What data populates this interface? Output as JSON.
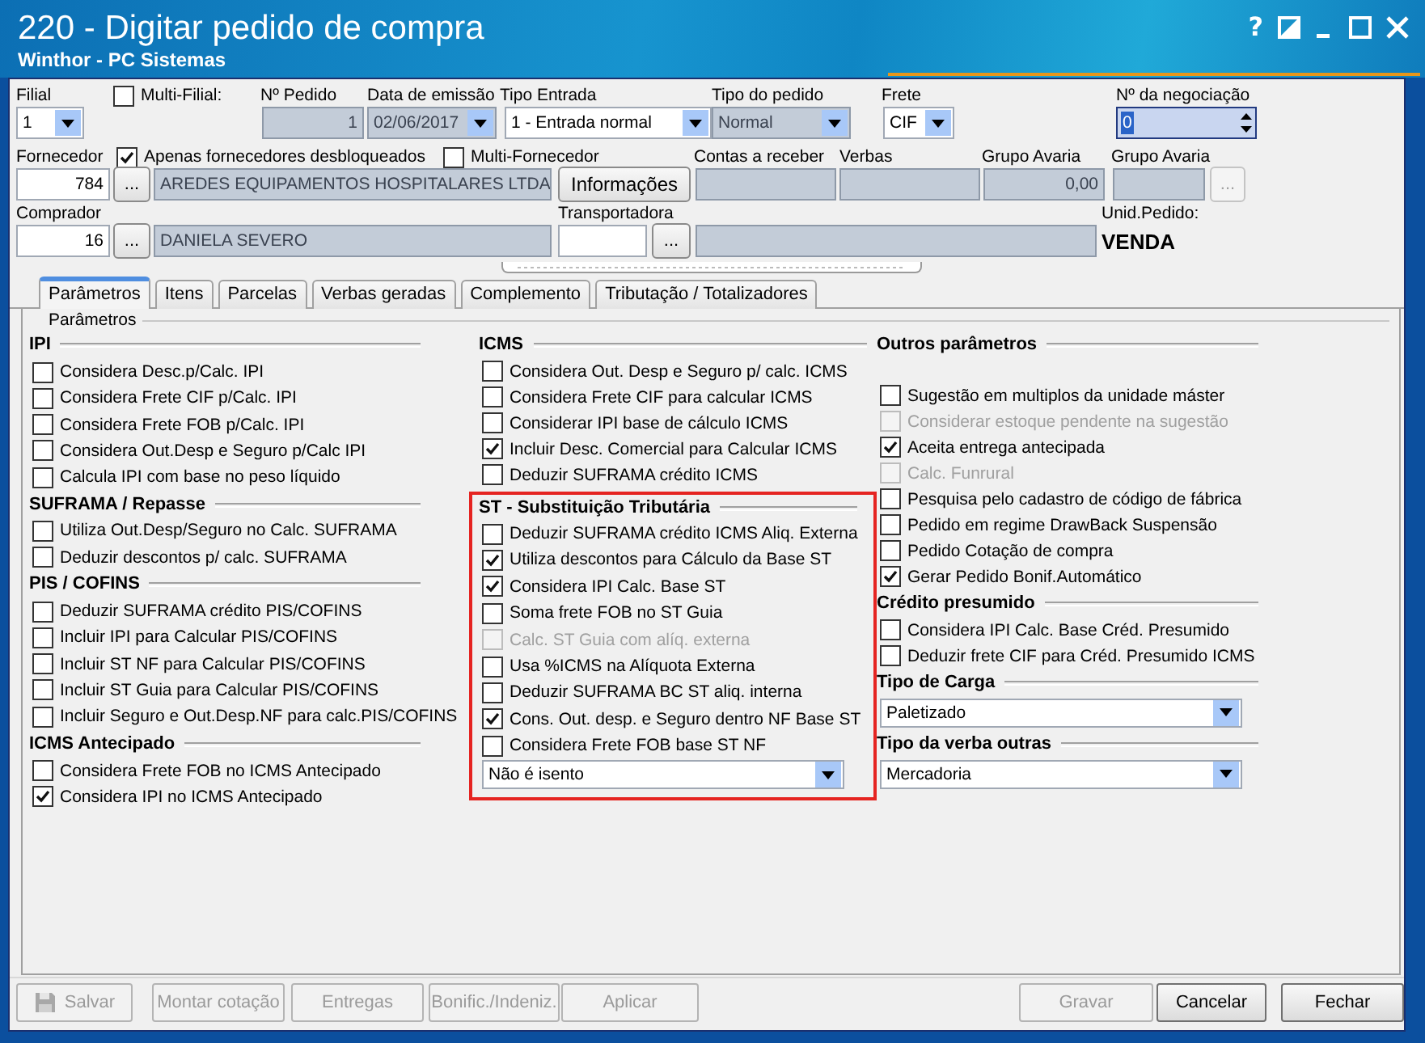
{
  "window": {
    "title": "220 - Digitar pedido de compra",
    "subtitle": "Winthor - PC Sistemas",
    "help": "?"
  },
  "header": {
    "rows": [
      {
        "labels": [
          {
            "kind": "label",
            "text": "Filial"
          },
          {
            "kind": "checkbox",
            "label": "Multi-Filial:",
            "checked": false
          },
          {
            "kind": "label",
            "text": "Nº Pedido"
          },
          {
            "kind": "label",
            "text": "Data de emissão"
          },
          {
            "kind": "label",
            "text": "Tipo Entrada"
          },
          {
            "kind": "label",
            "text": "Tipo do pedido"
          },
          {
            "kind": "label",
            "text": "Frete"
          },
          {
            "kind": "label",
            "text": "Nº da negociação"
          }
        ],
        "controls": [
          {
            "kind": "select",
            "value": "1",
            "disabled": false
          },
          {
            "kind": "number",
            "value": "1",
            "disabled": true
          },
          {
            "kind": "select",
            "value": "02/06/2017",
            "disabled": true
          },
          {
            "kind": "select",
            "value": "1 - Entrada normal",
            "disabled": false
          },
          {
            "kind": "select",
            "value": "Normal",
            "disabled": true
          },
          {
            "kind": "select",
            "value": "CIF",
            "disabled": false
          },
          {
            "kind": "spinner",
            "value": "0",
            "disabled": false
          }
        ]
      },
      {
        "labels": [
          {
            "kind": "label",
            "text": "Fornecedor"
          },
          {
            "kind": "checkbox",
            "label": "Apenas fornecedores desbloqueados",
            "checked": true
          },
          {
            "kind": "checkbox",
            "label": "Multi-Fornecedor",
            "checked": false
          },
          {
            "kind": "label",
            "text": "Contas a receber"
          },
          {
            "kind": "label",
            "text": "Verbas"
          },
          {
            "kind": "label",
            "text": "Grupo Avaria"
          },
          {
            "kind": "label",
            "text": "Grupo Avaria"
          }
        ],
        "controls": [
          {
            "kind": "number",
            "value": "784",
            "disabled": false
          },
          {
            "kind": "ellipsis",
            "label": "...",
            "disabled": false
          },
          {
            "kind": "text",
            "value": "AREDES EQUIPAMENTOS HOSPITALARES LTDA",
            "disabled": true
          },
          {
            "kind": "button",
            "label": "Informações",
            "disabled": false
          },
          {
            "kind": "text",
            "disabled": true
          },
          {
            "kind": "text",
            "disabled": true
          },
          {
            "kind": "number",
            "value": "0,00",
            "disabled": true
          },
          {
            "kind": "text",
            "disabled": true
          },
          {
            "kind": "ellipsis",
            "label": "...",
            "disabled": true
          }
        ]
      },
      {
        "labels": [
          {
            "kind": "label",
            "text": "Comprador"
          },
          {
            "kind": "label",
            "text": "Transportadora"
          },
          {
            "kind": "label",
            "text": "Unid.Pedido:"
          }
        ],
        "controls": [
          {
            "kind": "number",
            "value": "16",
            "disabled": false
          },
          {
            "kind": "ellipsis",
            "label": "...",
            "disabled": false
          },
          {
            "kind": "text",
            "value": "DANIELA SEVERO",
            "disabled": true
          },
          {
            "kind": "text",
            "disabled": false
          },
          {
            "kind": "ellipsis",
            "label": "...",
            "disabled": false
          },
          {
            "kind": "text",
            "disabled": true
          },
          {
            "kind": "bold",
            "value": "VENDA"
          }
        ]
      }
    ]
  },
  "tabs": [
    {
      "label": "Parâmetros",
      "selected": true
    },
    {
      "label": "Itens",
      "selected": false
    },
    {
      "label": "Parcelas",
      "selected": false
    },
    {
      "label": "Verbas geradas",
      "selected": false
    },
    {
      "label": "Complemento",
      "selected": false
    },
    {
      "label": "Tributação / Totalizadores",
      "selected": false
    }
  ],
  "parameters": {
    "title": "Parâmetros",
    "columns": [
      {
        "sections": [
          {
            "title": "IPI",
            "highlighted": false,
            "items": [
              {
                "kind": "checkbox",
                "label": "Considera Desc.p/Calc. IPI",
                "checked": false,
                "disabled": false
              },
              {
                "kind": "checkbox",
                "label": "Considera Frete CIF p/Calc. IPI",
                "checked": false,
                "disabled": false
              },
              {
                "kind": "checkbox",
                "label": "Considera Frete FOB p/Calc. IPI",
                "checked": false,
                "disabled": false
              },
              {
                "kind": "checkbox",
                "label": "Considera Out.Desp e Seguro p/Calc IPI",
                "checked": false,
                "disabled": false
              },
              {
                "kind": "checkbox",
                "label": "Calcula IPI com base no peso líquido",
                "checked": false,
                "disabled": false
              }
            ]
          },
          {
            "title": "SUFRAMA / Repasse",
            "highlighted": false,
            "items": [
              {
                "kind": "checkbox",
                "label": "Utiliza Out.Desp/Seguro no Calc. SUFRAMA",
                "checked": false,
                "disabled": false
              },
              {
                "kind": "checkbox",
                "label": "Deduzir descontos p/ calc. SUFRAMA",
                "checked": false,
                "disabled": false
              }
            ]
          },
          {
            "title": "PIS / COFINS",
            "highlighted": false,
            "items": [
              {
                "kind": "checkbox",
                "label": "Deduzir SUFRAMA crédito PIS/COFINS",
                "checked": false,
                "disabled": false
              },
              {
                "kind": "checkbox",
                "label": "Incluir IPI para Calcular PIS/COFINS",
                "checked": false,
                "disabled": false
              },
              {
                "kind": "checkbox",
                "label": "Incluir ST NF para Calcular PIS/COFINS",
                "checked": false,
                "disabled": false
              },
              {
                "kind": "checkbox",
                "label": "Incluir ST Guia para Calcular PIS/COFINS",
                "checked": false,
                "disabled": false
              },
              {
                "kind": "checkbox",
                "label": "Incluir Seguro e Out.Desp.NF para calc.PIS/COFINS",
                "checked": false,
                "disabled": false
              }
            ]
          },
          {
            "title": "ICMS Antecipado",
            "highlighted": false,
            "items": [
              {
                "kind": "checkbox",
                "label": "Considera Frete FOB no ICMS Antecipado",
                "checked": false,
                "disabled": false
              },
              {
                "kind": "checkbox",
                "label": "Considera IPI no ICMS Antecipado",
                "checked": true,
                "disabled": false
              }
            ]
          }
        ]
      },
      {
        "sections": [
          {
            "title": "ICMS",
            "highlighted": false,
            "items": [
              {
                "kind": "checkbox",
                "label": "Considera Out. Desp e Seguro p/ calc. ICMS",
                "checked": false,
                "disabled": false
              },
              {
                "kind": "checkbox",
                "label": "Considera Frete CIF para calcular ICMS",
                "checked": false,
                "disabled": false
              },
              {
                "kind": "checkbox",
                "label": "Considerar IPI base de cálculo ICMS",
                "checked": false,
                "disabled": false
              },
              {
                "kind": "checkbox",
                "label": "Incluir Desc. Comercial  para Calcular ICMS",
                "checked": true,
                "disabled": false
              },
              {
                "kind": "checkbox",
                "label": "Deduzir SUFRAMA crédito ICMS",
                "checked": false,
                "disabled": false
              }
            ]
          },
          {
            "title": "ST - Substituição Tributária",
            "highlighted": true,
            "items": [
              {
                "kind": "checkbox",
                "label": "Deduzir SUFRAMA crédito ICMS Aliq. Externa",
                "checked": false,
                "disabled": false
              },
              {
                "kind": "checkbox",
                "label": "Utiliza descontos para Cálculo da Base ST",
                "checked": true,
                "disabled": false
              },
              {
                "kind": "checkbox",
                "label": "Considera IPI Calc. Base ST",
                "checked": true,
                "disabled": false
              },
              {
                "kind": "checkbox",
                "label": "Soma frete FOB no ST Guia",
                "checked": false,
                "disabled": false
              },
              {
                "kind": "checkbox",
                "label": "Calc. ST Guia com alíq. externa",
                "checked": false,
                "disabled": true
              },
              {
                "kind": "checkbox",
                "label": "Usa %ICMS na Alíquota Externa",
                "checked": false,
                "disabled": false
              },
              {
                "kind": "checkbox",
                "label": "Deduzir SUFRAMA BC ST aliq. interna",
                "checked": false,
                "disabled": false
              },
              {
                "kind": "checkbox",
                "label": "Cons. Out. desp. e Seguro dentro NF Base ST",
                "checked": true,
                "disabled": false
              },
              {
                "kind": "checkbox",
                "label": "Considera Frete FOB base ST NF",
                "checked": false,
                "disabled": false
              },
              {
                "kind": "select",
                "value": "Não é isento"
              }
            ]
          }
        ]
      },
      {
        "sections": [
          {
            "title": "Outros parâmetros",
            "highlighted": false,
            "items": [
              {
                "kind": "checkbox",
                "label": "Sugestão em multiplos da unidade máster",
                "checked": false,
                "disabled": false
              },
              {
                "kind": "checkbox",
                "label": "Considerar estoque pendente na sugestão",
                "checked": false,
                "disabled": true
              },
              {
                "kind": "checkbox",
                "label": "Aceita entrega antecipada",
                "checked": true,
                "disabled": false
              },
              {
                "kind": "checkbox",
                "label": "Calc. Funrural",
                "checked": false,
                "disabled": true
              },
              {
                "kind": "checkbox",
                "label": "Pesquisa pelo cadastro de código de fábrica",
                "checked": false,
                "disabled": false
              },
              {
                "kind": "checkbox",
                "label": "Pedido em regime DrawBack Suspensão",
                "checked": false,
                "disabled": false
              },
              {
                "kind": "checkbox",
                "label": "Pedido Cotação de compra",
                "checked": false,
                "disabled": false
              },
              {
                "kind": "checkbox",
                "label": "Gerar Pedido Bonif.Automático",
                "checked": true,
                "disabled": false
              }
            ]
          },
          {
            "title": "Crédito presumido",
            "highlighted": false,
            "items": [
              {
                "kind": "checkbox",
                "label": "Considera IPI Calc. Base Créd. Presumido",
                "checked": false,
                "disabled": false
              },
              {
                "kind": "checkbox",
                "label": "Deduzir frete CIF para Créd. Presumido ICMS",
                "checked": false,
                "disabled": false
              }
            ]
          },
          {
            "title": "Tipo de Carga",
            "highlighted": false,
            "items": [
              {
                "kind": "select",
                "value": "Paletizado"
              }
            ]
          },
          {
            "title": "Tipo da verba outras",
            "highlighted": false,
            "items": [
              {
                "kind": "select",
                "value": "Mercadoria"
              }
            ]
          }
        ]
      }
    ]
  },
  "left_buttons": [
    {
      "label": "Salvar",
      "kind": "icon",
      "disabled": true
    },
    {
      "label": "Montar cotação",
      "kind": "text",
      "disabled": true
    },
    {
      "label": "Entregas",
      "kind": "text",
      "disabled": true
    },
    {
      "label": "Bonific./Indeniz.",
      "kind": "text",
      "disabled": true
    },
    {
      "label": "Aplicar",
      "kind": "text",
      "disabled": true
    }
  ],
  "right_buttons": [
    {
      "label": "Gravar",
      "kind": "text",
      "disabled": true
    },
    {
      "label": "Cancelar",
      "kind": "text",
      "disabled": false
    },
    {
      "label": "Fechar",
      "kind": "text",
      "disabled": false
    }
  ]
}
